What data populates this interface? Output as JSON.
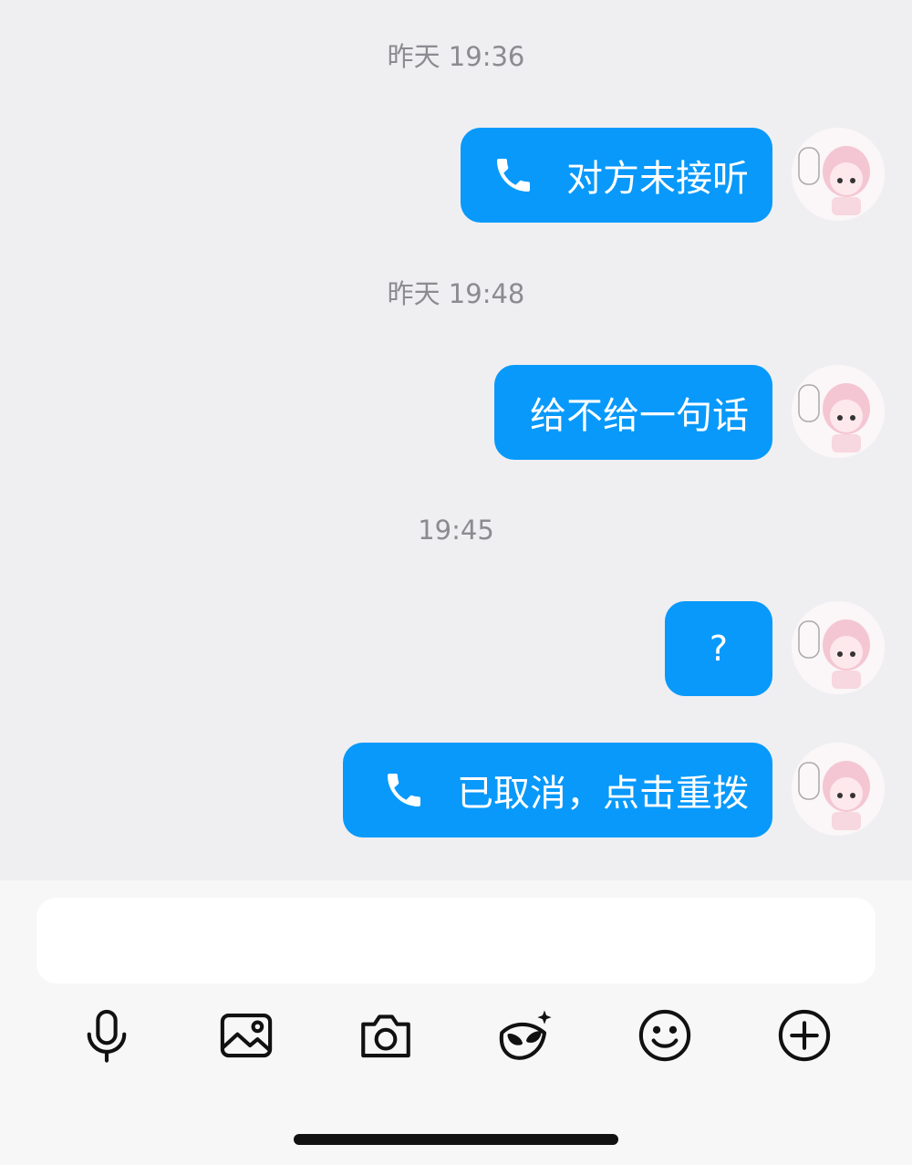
{
  "chat": {
    "timestamps": [
      "昨天 19:36",
      "昨天 19:48",
      "19:45"
    ],
    "messages": [
      {
        "text": "对方未接听",
        "call_icon": "phone-icon"
      },
      {
        "text": "给不给一句话"
      },
      {
        "text": "?"
      },
      {
        "text": "已取消，点击重拨",
        "call_icon": "phone-icon"
      }
    ]
  },
  "composer": {
    "input_placeholder": "",
    "tools": [
      "microphone-icon",
      "image-icon",
      "camera-icon",
      "mask-sparkle-icon",
      "smile-icon",
      "plus-circle-icon"
    ]
  },
  "colors": {
    "bubble": "#0899fb",
    "background": "#efeff1",
    "timestamp": "#8b8b90"
  }
}
